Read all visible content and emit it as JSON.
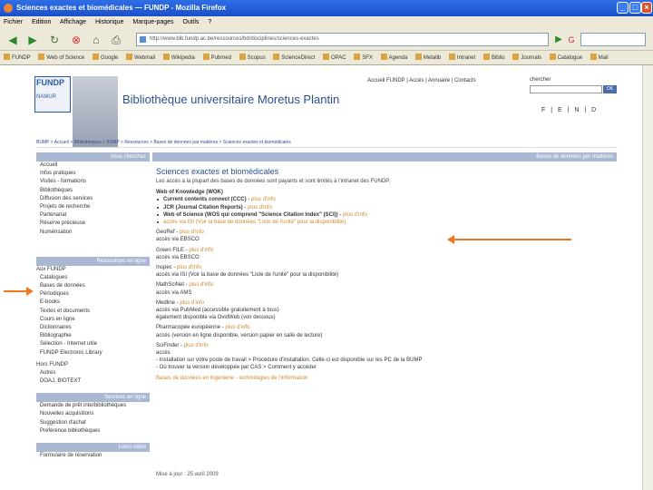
{
  "window": {
    "title": "Sciences exactes et biomédicales — FUNDP - Mozilla Firefox",
    "menu": [
      "Fichier",
      "Edition",
      "Affichage",
      "Historique",
      "Marque-pages",
      "Outils",
      "?"
    ]
  },
  "toolbar": {
    "url": "http://www.bib.fundp.ac.be/ressources/bd/disciplines/sciences-exactes",
    "bookmarks": [
      "FUNDP",
      "Web of Science",
      "Google",
      "Webmail",
      "Wikipedia",
      "Pubmed",
      "Scopus",
      "ScienceDirect",
      "OPAC",
      "SFX",
      "Agenda",
      "Metalib",
      "Intranet",
      "Biblio",
      "Journals",
      "Catalogue",
      "Mail"
    ]
  },
  "header": {
    "logo_text": "FUNDP",
    "logo_sub": "NAMUR",
    "site_title": "Bibliothèque universitaire Moretus Plantin",
    "top_links": "Accueil FUNDP | Accès | Annuaire | Contacts",
    "search_label": "chercher",
    "search_go": "OK",
    "lang_links": "F | E | N | D"
  },
  "breadcrumb": "BUMP > Accueil > Bibliothèques > BUMP > Ressources > Bases de données par matières > Sciences exactes et biomédicales",
  "sidebar": {
    "head1": "Vous cherchez",
    "group1": [
      "Accueil",
      "Infos pratiques",
      "Visites - formations",
      "Bibliothèques",
      "Diffusion des services",
      "Projets de recherche",
      "Partenariat",
      "Réserve précieuse",
      "Numérisation"
    ],
    "head2": "Ressources en ligne",
    "group2_label": "Aux FUNDP",
    "group2": [
      "Catalogues",
      "Bases de données",
      "Périodiques",
      "E-books",
      "Textes et documents",
      "Cours en ligne",
      "Dictionnaires",
      "Bibliographie",
      "Sélection - Internet utile",
      "FUNDP Electronic Library"
    ],
    "group3_label": "Hors FUNDP",
    "group3": [
      "Autres",
      "DOAJ, BIOTEXT"
    ],
    "head3": "Services en ligne",
    "group4": [
      "Demande de prêt interbibliothèques",
      "Nouvelles acquisitions",
      "Suggestion d'achat",
      "Préférence bibliothèques"
    ],
    "head4": "Liens utiles",
    "group5": [
      "Formulaire de réservation"
    ]
  },
  "content": {
    "section_head": "Bases de données par matières",
    "title": "Sciences exactes et biomédicales",
    "intro": "Les accès à la plupart des bases de données sont payants et sont limités à l'intranet des FUNDP.",
    "wok_heading": "Web of Knowledge (WOK)",
    "wok_items": [
      {
        "name": "Current contents connect (CCC)",
        "link": "plus d'info"
      },
      {
        "name": "JCR (Journal Citation Reports)",
        "link": "plus d'info"
      },
      {
        "name": "Web of Science (WOS qui comprend \"Science Citation Index\" (SCI))",
        "link": "plus d'info"
      },
      {
        "name": "accès via ISI (Voir la base de données \"Liste de l'unité\" pour la disponibilité)",
        "link": ""
      }
    ],
    "databases": [
      {
        "name": "GeoRef",
        "link": "plus d'info",
        "access": "accès via EBSCO"
      },
      {
        "name": "Green FILE",
        "link": "plus d'info",
        "access": "accès via EBSCO"
      },
      {
        "name": "Inspec",
        "link": "plus d'info",
        "access": "accès via ISI (Voir la base de données \"Liste de l'unité\" pour la disponibilité)"
      },
      {
        "name": "MathSciNet",
        "link": "plus d'info",
        "access": "accès via AMS"
      },
      {
        "name": "Medline",
        "link": "plus d'info",
        "access": "accès via PubMed (accessible gratuitement à tous)\négalement disponible via OvidWeb (voir dessous)"
      },
      {
        "name": "Pharmacopée européenne",
        "link": "plus d'info",
        "access": "accès (version en ligne disponible, version papier en salle de lecture)"
      },
      {
        "name": "SciFinder",
        "link": "plus d'info",
        "access": "accès\n- Installation sur votre poste de travail > Procédure d'installation. Celle-ci est disponible sur les PC de la BUMP\n- Où trouver la version développée par CAS > Comment y accéder"
      }
    ],
    "extra_link": "Bases de données en Ingénierie - technologies de l'information",
    "updated": "Mise à jour : 25 avril 2009"
  }
}
